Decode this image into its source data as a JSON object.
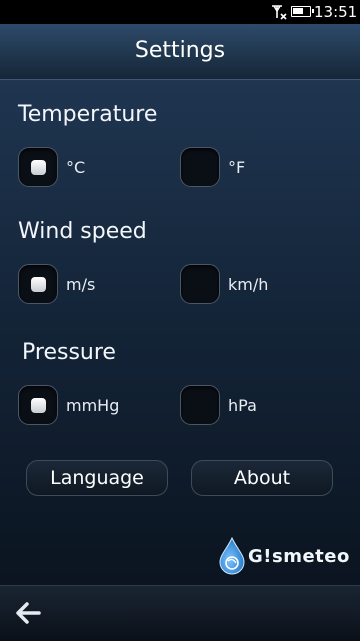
{
  "status_bar": {
    "time": "13:51",
    "battery_level": 0.7
  },
  "header": {
    "title": "Settings"
  },
  "temperature": {
    "title": "Temperature",
    "options": [
      {
        "label": "°C",
        "selected": true
      },
      {
        "label": "°F",
        "selected": false
      }
    ]
  },
  "wind_speed": {
    "title": "Wind speed",
    "options": [
      {
        "label": "m/s",
        "selected": true
      },
      {
        "label": "km/h",
        "selected": false
      }
    ]
  },
  "pressure": {
    "title": "Pressure",
    "options": [
      {
        "label": "mmHg",
        "selected": true
      },
      {
        "label": "hPa",
        "selected": false
      }
    ]
  },
  "buttons": {
    "language": "Language",
    "about": "About"
  },
  "logo": {
    "text": "G!smeteo"
  },
  "icons": {
    "back": "back-arrow-icon",
    "signal": "no-signal-icon",
    "battery": "battery-icon"
  },
  "colors": {
    "accent": "#2d8ad8",
    "background": "#0d1826"
  }
}
